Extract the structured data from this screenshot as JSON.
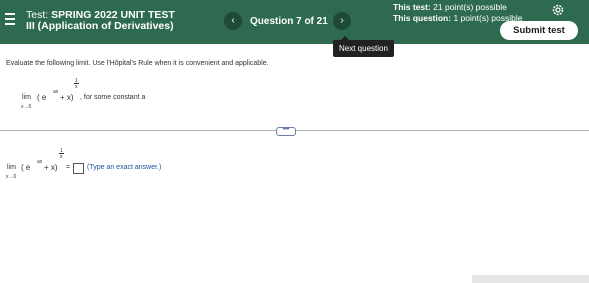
{
  "header": {
    "test_prefix": "Test:",
    "test_title_line1": "SPRING 2022 UNIT TEST",
    "test_title_line2": "III (Application of Derivatives)",
    "prev_label": "‹",
    "next_label": "›",
    "question_counter": "Question 7 of 21",
    "points_test_label": "This test:",
    "points_test_value": "21 point(s) possible",
    "points_question_label": "This question:",
    "points_question_value": "1 point(s) possible",
    "submit_label": "Submit test",
    "tooltip": "Next question",
    "brand_color": "#2e6a4f"
  },
  "question": {
    "instructions": "Evaluate the following limit. Use l'Hôpital's Rule when it is convenient and applicable.",
    "limit_word": "lim",
    "limit_sub": "x→0",
    "exponent": "1",
    "exponent_den": "x",
    "expression": "( e",
    "e_power": "ax",
    "expression_tail": "+ x)",
    "constant_note": ", for some constant a",
    "answer_equals": "=",
    "answer_hint": "(Type an exact answer.)",
    "more_label": "•••"
  }
}
